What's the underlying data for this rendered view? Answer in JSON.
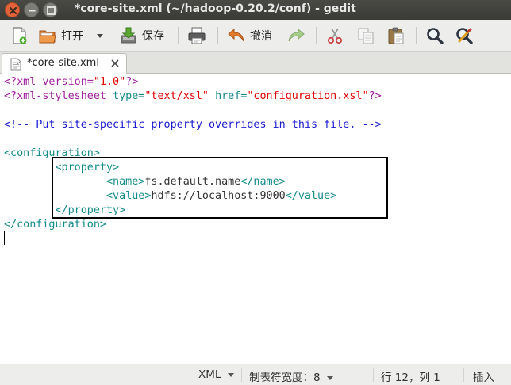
{
  "window": {
    "title": "*core-site.xml (~/hadoop-0.20.2/conf) - gedit"
  },
  "toolbar": {
    "open_label": "打开",
    "save_label": "保存",
    "undo_label": "撤消"
  },
  "tab": {
    "label": "*core-site.xml"
  },
  "editor": {
    "lines": [
      [
        [
          "<?xml ",
          "c-purple"
        ],
        [
          "version=",
          "c-purple"
        ],
        [
          "\"1.0\"",
          "c-red"
        ],
        [
          "?>",
          "c-purple"
        ]
      ],
      [
        [
          "<?xml-stylesheet ",
          "c-purple"
        ],
        [
          "type=",
          "c-teal"
        ],
        [
          "\"text/xsl\"",
          "c-red"
        ],
        [
          " ",
          "c-dark"
        ],
        [
          "href=",
          "c-teal"
        ],
        [
          "\"configuration.xsl\"",
          "c-red"
        ],
        [
          "?>",
          "c-purple"
        ]
      ],
      [],
      [
        [
          "<!-- Put site-specific property overrides in this file. -->",
          "c-blue"
        ]
      ],
      [],
      [
        [
          "<configuration>",
          "c-teal"
        ]
      ],
      [
        [
          "        ",
          "c-dark"
        ],
        [
          "<property>",
          "c-teal"
        ]
      ],
      [
        [
          "                ",
          "c-dark"
        ],
        [
          "<name>",
          "c-teal"
        ],
        [
          "fs.default.name",
          "c-dark"
        ],
        [
          "</name>",
          "c-teal"
        ]
      ],
      [
        [
          "                ",
          "c-dark"
        ],
        [
          "<value>",
          "c-teal"
        ],
        [
          "hdfs://localhost:9000",
          "c-dark"
        ],
        [
          "</value>",
          "c-teal"
        ]
      ],
      [
        [
          "        ",
          "c-dark"
        ],
        [
          "</property>",
          "c-teal"
        ]
      ],
      [
        [
          "</configuration>",
          "c-teal"
        ]
      ],
      []
    ]
  },
  "statusbar": {
    "language": "XML",
    "tab_width": "制表符宽度：8",
    "position": "行 12，列 1",
    "mode": "插入"
  },
  "colors": {
    "titlebar": "#3b3b37",
    "close_button": "#e0633a",
    "xml_tag": "#138a8a",
    "xml_string": "#e00000",
    "xml_comment": "#1a1ad0",
    "xml_decl": "#a020a0"
  }
}
